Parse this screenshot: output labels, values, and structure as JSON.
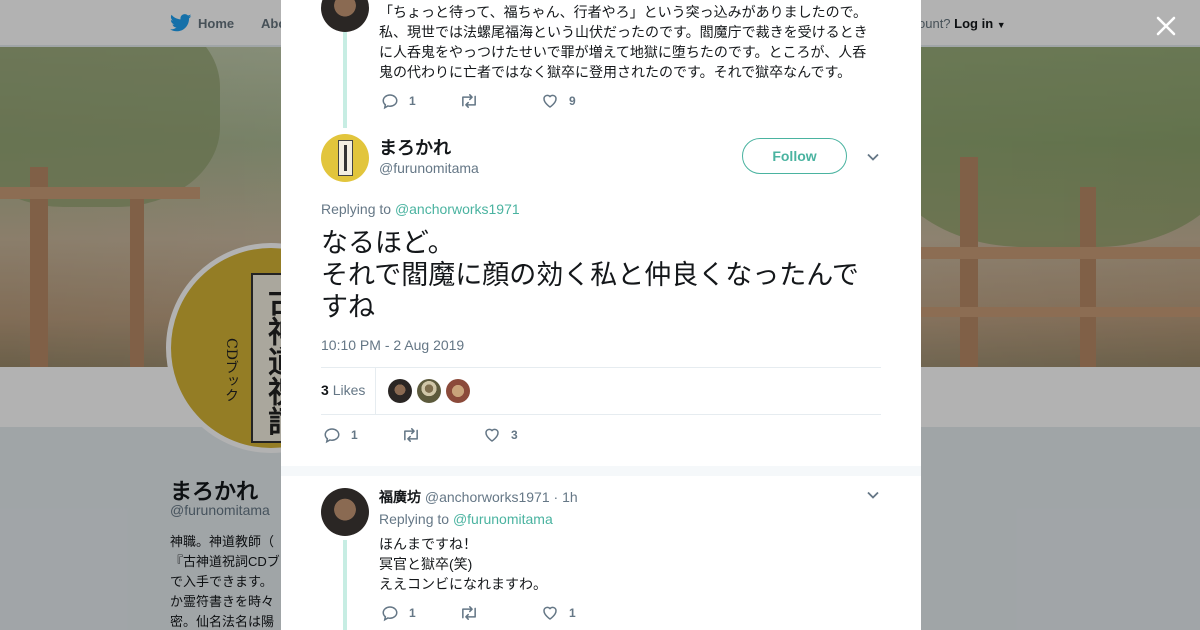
{
  "nav": {
    "home_label": "Home",
    "about_label": "Abo",
    "account_prompt": "ccount?",
    "login_label": "Log in"
  },
  "profile": {
    "name": "まろかれ",
    "handle": "@furunomitama",
    "bio": "神職。神道教師（\n『古神道祝詞CDブ\nで入手できます。\nか霊符書きを時々\n密。仙名法名は陽",
    "avatar_title": "古神道祝詞",
    "avatar_sub": "CDブック"
  },
  "modal": {
    "prev_tweet": {
      "text": "「ちょっと待って、福ちゃん、行者やろ」という突っ込みがありましたので。\n私、現世では法螺尾福海という山伏だったのです。閻魔庁で裁きを受けるとき\nに人呑鬼をやっつけたせいで罪が増えて地獄に堕ちたのです。ところが、人呑\n鬼の代わりに亡者ではなく獄卒に登用されたのです。それで獄卒なんです。",
      "replies": "1",
      "retweets": "",
      "likes": "9"
    },
    "main_tweet": {
      "name": "まろかれ",
      "handle": "@furunomitama",
      "follow_label": "Follow",
      "replying_prefix": "Replying to",
      "replying_to": "@anchorworks1971",
      "text": "なるほど。\nそれで閻魔に顔の効く私と仲良くなったんで\nすね",
      "timestamp": "10:10 PM - 2 Aug 2019",
      "likes_count": "3",
      "likes_label": "Likes",
      "replies": "1",
      "retweets": "",
      "likes": "3"
    },
    "reply_tweet": {
      "name": "福廣坊",
      "handle": "@anchorworks1971",
      "time": "· 1h",
      "replying_prefix": "Replying to",
      "replying_to": "@furunomitama",
      "text": "ほんまですね！\n冥官と獄卒(笑)\nええコンビになれますわ。",
      "replies": "1",
      "retweets": "",
      "likes": "1"
    }
  },
  "colors": {
    "accent": "#4ab3a0",
    "twitter_blue": "#1da1f2",
    "thread_line": "#c7ede3",
    "text_primary": "#14171a",
    "text_secondary": "#657786"
  },
  "icons": [
    "twitter-bird-icon",
    "close-icon",
    "reply-icon",
    "retweet-icon",
    "heart-icon",
    "chevron-down-icon"
  ]
}
